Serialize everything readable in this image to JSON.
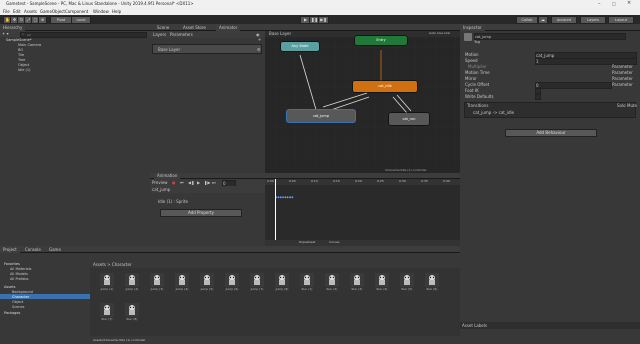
{
  "window": {
    "title": "Gametest - SampleScene - PC, Mac & Linux Standalone - Unity 2019.4.9f1 Personal* <DX11>"
  },
  "menu": [
    "File",
    "Edit",
    "Assets",
    "GameObject",
    "Component",
    "Window",
    "Help"
  ],
  "toolbar": {
    "pivot": "Pivot",
    "local": "Local",
    "collab": "Collab",
    "account": "Account",
    "layers": "Layers",
    "layout": "Layout"
  },
  "hierarchy": {
    "tab": "Hierarchy",
    "search_placeholder": "All",
    "items": [
      "SampleScene*",
      "Main Camera",
      "BG",
      "Tile",
      "Tree",
      "Object",
      "Idle (1)"
    ]
  },
  "center_tabs": [
    "Scene",
    "Asset Store",
    "Animator"
  ],
  "animator": {
    "sub_tabs": [
      "Layers",
      "Parameters"
    ],
    "base_layer": "Base Layer",
    "breadcrumb": "Base Layer",
    "auto_live": "Auto Live Link",
    "states": {
      "any": "Any State",
      "entry": "Entry",
      "jump": "cat_jump",
      "idle": "cat_idle",
      "run": "cat_run",
      "exit": "Exit"
    },
    "footer": "Character/Idle (1).controller"
  },
  "animation": {
    "tab": "Animation",
    "preview": "Preview",
    "frame": "0",
    "clip": "cat_jump",
    "property": "Idle (1) : Sprite",
    "add_property": "Add Property",
    "times": [
      "0:00",
      "0:05",
      "0:10",
      "0:15",
      "0:20",
      "0:25",
      "0:30",
      "0:35",
      "0:40"
    ],
    "dopesheet": "Dopesheet",
    "curves": "Curves",
    "samples": "0"
  },
  "inspector": {
    "tab": "Inspector",
    "name": "cat_jump",
    "tag": "Tag",
    "fields": [
      {
        "label": "Motion",
        "value": "cat_jump"
      },
      {
        "label": "Speed",
        "value": "1"
      },
      {
        "label": "Multiplier",
        "value": "Parameter"
      },
      {
        "label": "Motion Time",
        "value": "Parameter"
      },
      {
        "label": "Mirror",
        "value": "Parameter"
      },
      {
        "label": "Cycle Offset",
        "value": "0"
      },
      {
        "label": "Foot IK",
        "value": ""
      },
      {
        "label": "Write Defaults",
        "value": ""
      }
    ],
    "cycle_param": "Parameter",
    "transitions_label": "Transitions",
    "solo": "Solo",
    "mute": "Mute",
    "transition": "cat_jump -> cat_idle",
    "add_behaviour": "Add Behaviour",
    "asset_labels": "Asset Labels"
  },
  "project": {
    "tabs": [
      "Project",
      "Console",
      "Game"
    ],
    "favorites": "Favorites",
    "fav_items": [
      "All Materials",
      "All Models",
      "All Prefabs"
    ],
    "assets": "Assets",
    "asset_folders": [
      "Background",
      "Character",
      "Object",
      "Scenes"
    ],
    "packages": "Packages",
    "breadcrumb": "Assets > Character",
    "count": "12",
    "items": [
      "Jump (1)",
      "Jump (2)",
      "Jump (3)",
      "Jump (4)",
      "Jump (5)",
      "Jump (6)",
      "Jump (7)",
      "Jump (8)",
      "Run (1)",
      "Run (2)",
      "Run (3)",
      "Run (4)",
      "Run (5)",
      "Run (6)",
      "Run (7)",
      "Run (8)"
    ],
    "status": "Assets/Character/Idle (1).controller"
  },
  "colors": {
    "accent": "#3a72b0",
    "entry": "#1f7a3a",
    "any": "#5aa0a0",
    "default": "#d07010",
    "exit": "#8a1f1f"
  }
}
